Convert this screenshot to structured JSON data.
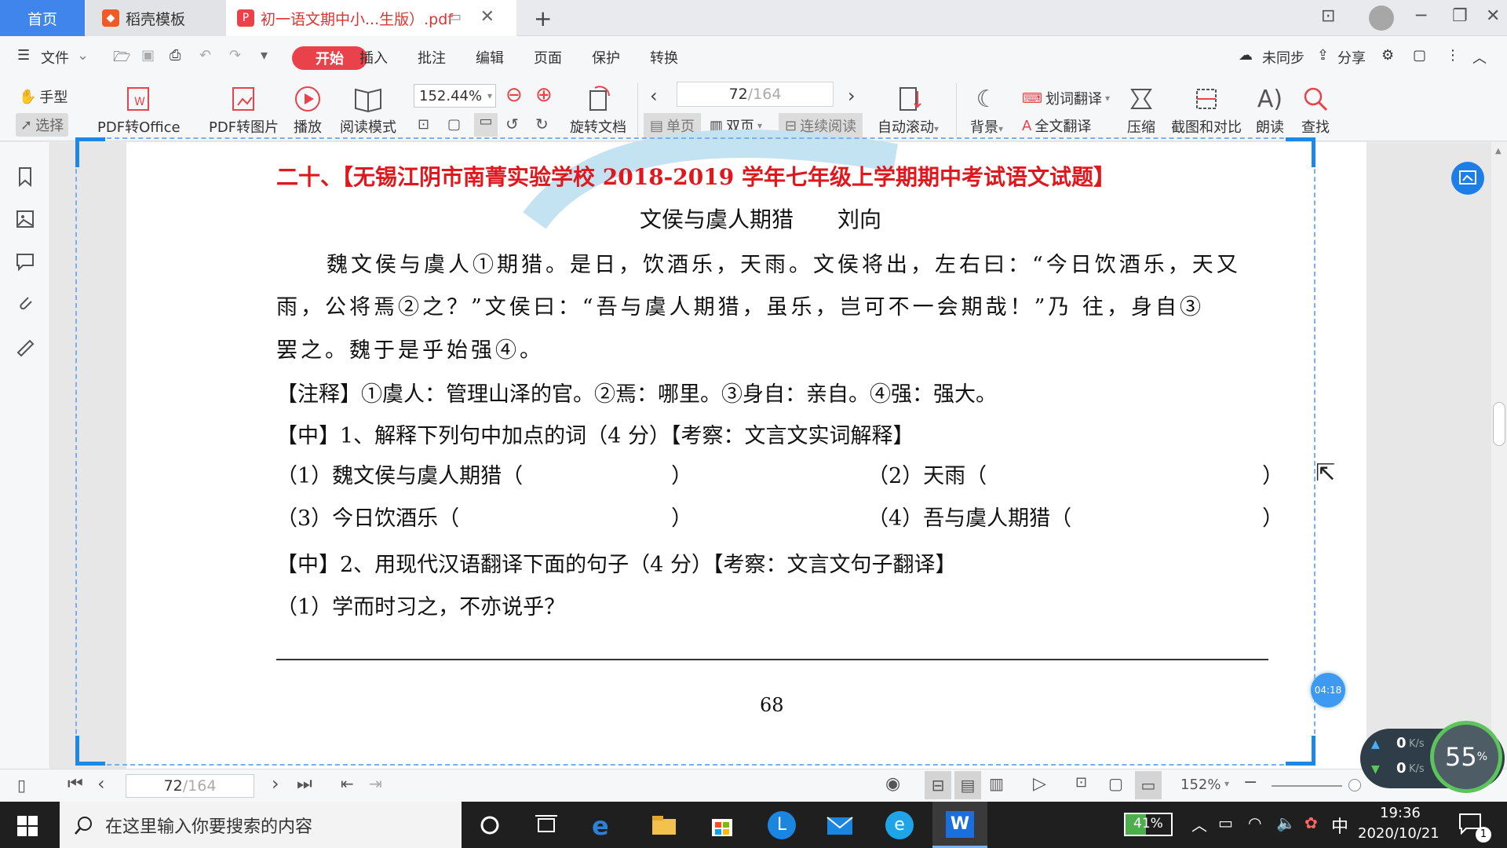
{
  "tabs": {
    "home": "首页",
    "docer": "稻壳模板",
    "pdf": "初一语文期中小...生版）.pdf"
  },
  "menu": {
    "file": "文件",
    "start": "开始",
    "items": [
      "插入",
      "批注",
      "编辑",
      "页面",
      "保护",
      "转换"
    ],
    "sync": "未同步",
    "share": "分享"
  },
  "ribbon": {
    "hand": "手型",
    "select": "选择",
    "pdf_office": "PDF转Office",
    "pdf_image": "PDF转图片",
    "play": "播放",
    "read_mode": "阅读模式",
    "zoom": "152.44%",
    "rotate": "旋转文档",
    "page_current": "72",
    "page_total": "/164",
    "single": "单页",
    "double": "双页",
    "continuous": "连续阅读",
    "auto_scroll": "自动滚动",
    "background": "背景",
    "word_translate": "划词翻译",
    "full_translate": "全文翻译",
    "compress": "压缩",
    "screenshot_compare": "截图和对比",
    "read_aloud": "朗读",
    "find": "查找"
  },
  "doc": {
    "heading": "二十、【无锡江阴市南菁实验学校 2018-2019 学年七年级上学期期中考试语文试题】",
    "subtitle": "文侯与虞人期猎　　刘向",
    "para1": "魏文侯与虞人①期猎。是日，饮酒乐，天雨。文侯将出，左右曰：“今日饮酒乐，天又",
    "para2": "雨，公将焉②之？”文侯曰：“吾与虞人期猎，虽乐，岂可不一会期哉！”乃 往，身自③",
    "para3": "罢之。魏于是乎始强④。",
    "note": "【注释】①虞人：管理山泽的官。②焉：哪里。③身自：亲自。④强：强大。",
    "q1": "【中】1、解释下列句中加点的词（4 分）【考察：文言文实词解释】",
    "q1_1": "（1）魏文侯与虞人期猎（　　　　　　　）",
    "q1_2": "（2）天雨（　　　　　　　　　　　　　）",
    "q1_3": "（3）今日饮酒乐（　　　　　　　　　　）",
    "q1_4": "（4）吾与虞人期猎（　　　　　　　　　）",
    "q2": "【中】2、用现代汉语翻译下面的句子（4 分）【考察：文言文句子翻译】",
    "q2_1": "（1）学而时习之，不亦说乎？",
    "page_number": "68"
  },
  "status": {
    "page_current": "72",
    "page_total": "/164",
    "zoom": "152%"
  },
  "overlay": {
    "timer": "04:18",
    "up_speed": "0",
    "down_speed": "0",
    "speed_unit": "K/s",
    "percent": "55",
    "percent_unit": "%"
  },
  "taskbar": {
    "search_placeholder": "在这里输入你要搜索的内容",
    "battery": "41%",
    "ime": "中",
    "time": "19:36",
    "date": "2020/10/21",
    "notifications": "1"
  },
  "colors": {
    "accent": "#e9424a",
    "heading": "#e0181e",
    "tab_home": "#3f85ec",
    "frame": "#1e88e5"
  }
}
